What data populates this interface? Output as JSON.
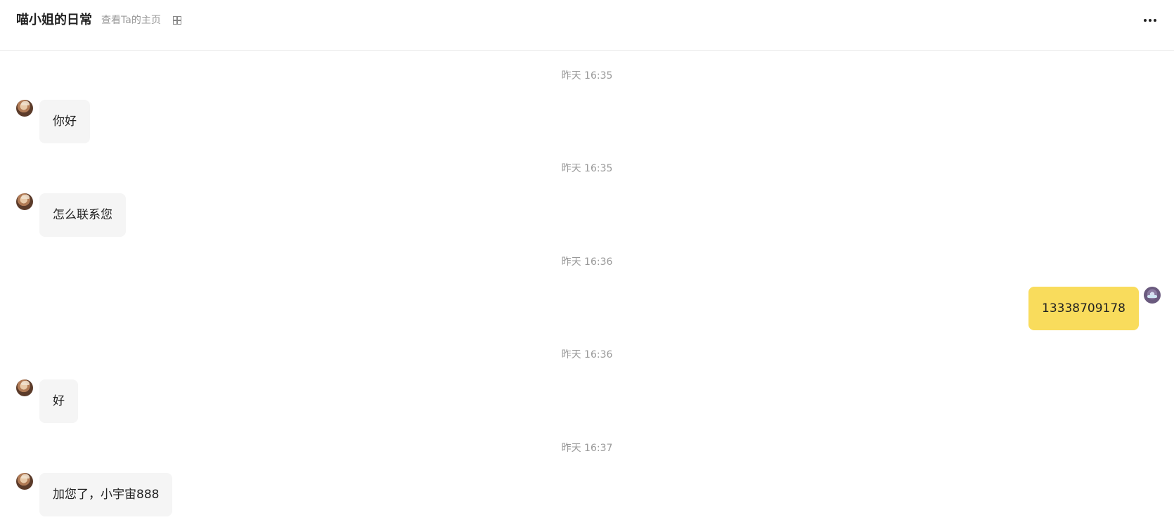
{
  "header": {
    "title": "喵小姐的日常",
    "profile_link": "查看Ta的主页",
    "qr_icon": "grid-qr-icon",
    "more_icon": "more-dots-icon"
  },
  "messages": [
    {
      "time": "昨天 16:35",
      "side": "left",
      "text": "你好"
    },
    {
      "time": "昨天 16:35",
      "side": "left",
      "text": "怎么联系您"
    },
    {
      "time": "昨天 16:36",
      "side": "right",
      "text": "13338709178"
    },
    {
      "time": "昨天 16:36",
      "side": "left",
      "text": "好"
    },
    {
      "time": "昨天 16:37",
      "side": "left",
      "text": "加您了，小宇宙888"
    }
  ],
  "colors": {
    "received_bubble": "#f5f5f5",
    "sent_bubble": "#f9dc5c",
    "timestamp": "#999999",
    "title": "#222222"
  }
}
